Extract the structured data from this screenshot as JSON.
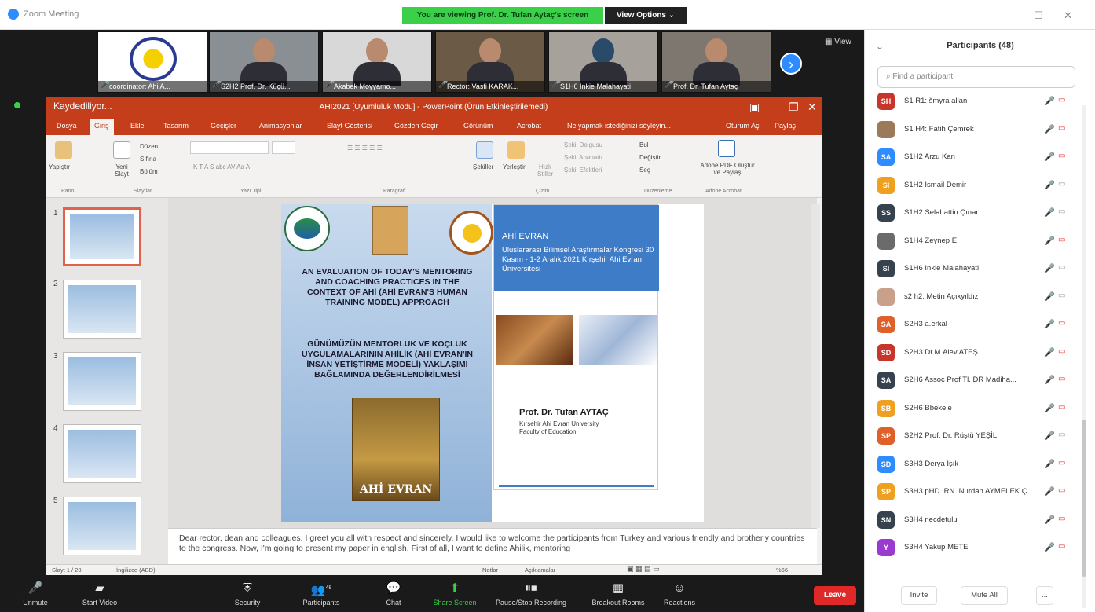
{
  "window": {
    "app_title": "Zoom Meeting",
    "banner": "You are viewing Prof. Dr. Tufan Aytaç's screen",
    "view_options": "View Options ⌄",
    "view_label": "View"
  },
  "thumbnails": [
    {
      "label": "coordinator: Ahi A..."
    },
    {
      "label": "S2H2 Prof. Dr. Küçü..."
    },
    {
      "label": "Akabek Moyyamo..."
    },
    {
      "label": "Rector: Vasfi KARAK..."
    },
    {
      "label": "S1H6 Inkie Malahayati"
    },
    {
      "label": "Prof. Dr. Tufan Aytaç"
    }
  ],
  "ppt": {
    "quick": "Kaydediliyor...",
    "title": "AHI2021 [Uyumluluk Modu] - PowerPoint (Ürün Etkinleştirilemedi)",
    "tabs": [
      "Dosya",
      "Giriş",
      "Ekle",
      "Tasarım",
      "Geçişler",
      "Animasyonlar",
      "Slayt Gösterisi",
      "Gözden Geçir",
      "Görünüm",
      "Acrobat",
      "Ne yapmak istediğinizi söyleyin...",
      "Oturum Aç",
      "Paylaş"
    ],
    "ribbon": {
      "paste": "Yapıştır",
      "new_slide": "Yeni Slayt",
      "layout": "Düzen",
      "reset": "Sıfırla",
      "section": "Bölüm",
      "shapes": "Şekiller",
      "arrange": "Yerleştir",
      "quick_styles": "Hızlı Stiller",
      "fill": "Şekil Dolgusu",
      "outline": "Şekil Anahattı",
      "effects": "Şekil Efektleri",
      "find": "Bul",
      "replace": "Değiştir",
      "select": "Seç",
      "adobe": "Adobe PDF Oluştur ve Paylaş",
      "groups": [
        "Pano",
        "Slaytlar",
        "Yazı Tipi",
        "Paragraf",
        "Çizim",
        "Düzenleme",
        "Adobe Acrobat"
      ]
    },
    "slide_numbers": [
      "1",
      "2",
      "3",
      "4",
      "5"
    ],
    "slide": {
      "title_en": "AN EVALUATION OF TODAY'S MENTORING AND COACHING PRACTICES IN THE CONTEXT OF AHİ (AHİ EVRAN'S HUMAN TRAINING MODEL) APPROACH",
      "title_tr": "GÜNÜMÜZÜN MENTORLUK VE KOÇLUK UYGULAMALARININ AHİLİK (AHİ EVRAN'IN İNSAN YETİŞTİRME MODELİ) YAKLAŞIMI BAĞLAMINDA DEĞERLENDİRİLMESİ",
      "painting_label": "AHİ EVRAN",
      "card_heading": "AHİ EVRAN",
      "card_body": "Uluslararası Bilimsel Araştırmalar Kongresi 30 Kasım - 1-2 Aralık 2021 Kırşehir Ahi Evran Üniversitesi",
      "author": "Prof. Dr. Tufan AYTAÇ",
      "aff1": "Kırşehir Ahi Evran University",
      "aff2": "Faculty of Education"
    },
    "notes": "Dear rector, dean and colleagues. I greet you all with respect and sincerely. I would like to welcome the participants from Turkey and various friendly and brotherly countries to the congress. Now, I'm going to present my paper in english. First of all, I want to define Ahilik, mentoring",
    "status": {
      "slide": "Slayt 1 / 20",
      "lang": "İngilizce (ABD)",
      "notes": "Notlar",
      "comments": "Açıklamalar",
      "zoom": "%66"
    }
  },
  "toolbar": {
    "unmute": "Unmute",
    "start_video": "Start Video",
    "security": "Security",
    "participants": "Participants",
    "participants_count": "48",
    "chat": "Chat",
    "share": "Share Screen",
    "record": "Pause/Stop Recording",
    "breakout": "Breakout Rooms",
    "reactions": "Reactions",
    "leave": "Leave"
  },
  "panel": {
    "title": "Participants (48)",
    "search_placeholder": "Find a participant",
    "invite": "Invite",
    "mute_all": "Mute All",
    "more": "...",
    "participants": [
      {
        "initials": "SH",
        "name": "S1 R1: šmyra allan",
        "color": "#c8352b",
        "cam_on": false
      },
      {
        "initials": "",
        "name": "S1 H4: Fatih Çemrek",
        "color": "#9b7a5a",
        "cam_on": false
      },
      {
        "initials": "SA",
        "name": "S1H2 Arzu Kan",
        "color": "#2d8cff",
        "cam_on": false
      },
      {
        "initials": "SI",
        "name": "S1H2 İsmail Demir",
        "color": "#f0a020",
        "cam_on": true
      },
      {
        "initials": "SS",
        "name": "S1H2 Selahattin Çınar",
        "color": "#37424f",
        "cam_on": true
      },
      {
        "initials": "",
        "name": "S1H4 Zeynep E.",
        "color": "#6b6b6b",
        "cam_on": false
      },
      {
        "initials": "SI",
        "name": "S1H6 Inkie Malahayati",
        "color": "#37424f",
        "cam_on": true
      },
      {
        "initials": "",
        "name": "s2 h2: Metin Açıkyıldız",
        "color": "#c9a08a",
        "cam_on": true
      },
      {
        "initials": "SA",
        "name": "S2H3 a.erkal",
        "color": "#e0602a",
        "cam_on": false
      },
      {
        "initials": "SD",
        "name": "S2H3 Dr.M.Alev ATEŞ",
        "color": "#c8352b",
        "cam_on": false
      },
      {
        "initials": "SA",
        "name": "S2H6 Assoc Prof Tl. DR Madiha...",
        "color": "#37424f",
        "cam_on": false
      },
      {
        "initials": "SB",
        "name": "S2H6 Bbekele",
        "color": "#f0a020",
        "cam_on": false
      },
      {
        "initials": "SP",
        "name": "S2H2 Prof. Dr. Rüştü YEŞİL",
        "color": "#e0602a",
        "cam_on": true
      },
      {
        "initials": "SD",
        "name": "S3H3 Derya Işık",
        "color": "#2d8cff",
        "cam_on": false
      },
      {
        "initials": "SP",
        "name": "S3H3 pHD. RN. Nurdan AYMELEK Ç...",
        "color": "#f0a020",
        "cam_on": false
      },
      {
        "initials": "SN",
        "name": "S3H4 necdetulu",
        "color": "#37424f",
        "cam_on": false
      },
      {
        "initials": "Y",
        "name": "S3H4 Yakup METE",
        "color": "#9b3ad0",
        "cam_on": false
      }
    ]
  }
}
